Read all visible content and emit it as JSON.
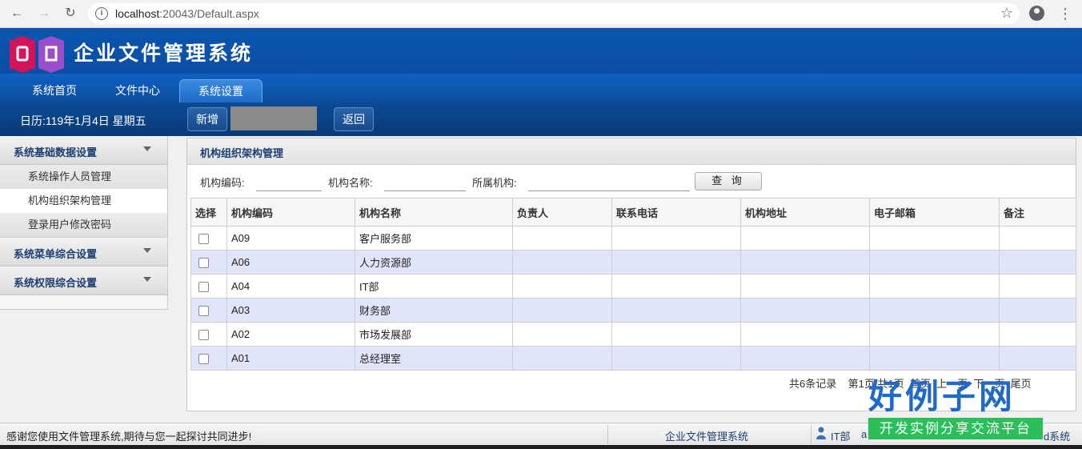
{
  "browser": {
    "url_host": "localhost",
    "url_path": ":20043/Default.aspx"
  },
  "app": {
    "title": "企业文件管理系统"
  },
  "tabs": [
    {
      "label": "系统首页"
    },
    {
      "label": "文件中心"
    },
    {
      "label": "系统设置",
      "active": true
    }
  ],
  "toolbar": {
    "date": "日历:119年1月4日 星期五",
    "add_label": "新增",
    "back_label": "返回"
  },
  "sidebar": {
    "groups": [
      {
        "label": "系统基础数据设置"
      },
      {
        "label": "系统菜单综合设置"
      },
      {
        "label": "系统权限综合设置"
      }
    ],
    "items": [
      {
        "label": "系统操作人员管理"
      },
      {
        "label": "机构组织架构管理",
        "active": true
      },
      {
        "label": "登录用户修改密码"
      }
    ]
  },
  "panel": {
    "title": "机构组织架构管理",
    "filters": {
      "code_label": "机构编码:",
      "name_label": "机构名称:",
      "parent_label": "所属机构:",
      "query_label": "查 询"
    },
    "columns": [
      "选择",
      "机构编码",
      "机构名称",
      "负责人",
      "联系电话",
      "机构地址",
      "电子邮箱",
      "备注"
    ],
    "rows": [
      {
        "code": "A09",
        "name": "客户服务部"
      },
      {
        "code": "A06",
        "name": "人力资源部"
      },
      {
        "code": "A04",
        "name": "IT部"
      },
      {
        "code": "A03",
        "name": "财务部"
      },
      {
        "code": "A02",
        "name": "市场发展部"
      },
      {
        "code": "A01",
        "name": "总经理室"
      }
    ],
    "pager": "共6条记录    第1页/共1页  首页  上一页  下一页  尾页"
  },
  "footer": {
    "message": "感谢您使用文件管理系统,期待与您一起探讨共同进步!",
    "system_name": "企业文件管理系统",
    "dept": "IT部",
    "user": "a",
    "right_text": "d系统"
  },
  "watermark": {
    "brand": "好例子网",
    "tagline": "开发实例分享交流平台"
  },
  "colors": {
    "header_blue": "#0b4ea3",
    "row_alt": "#e1e5fa",
    "sidebar_text": "#1d3e70"
  }
}
